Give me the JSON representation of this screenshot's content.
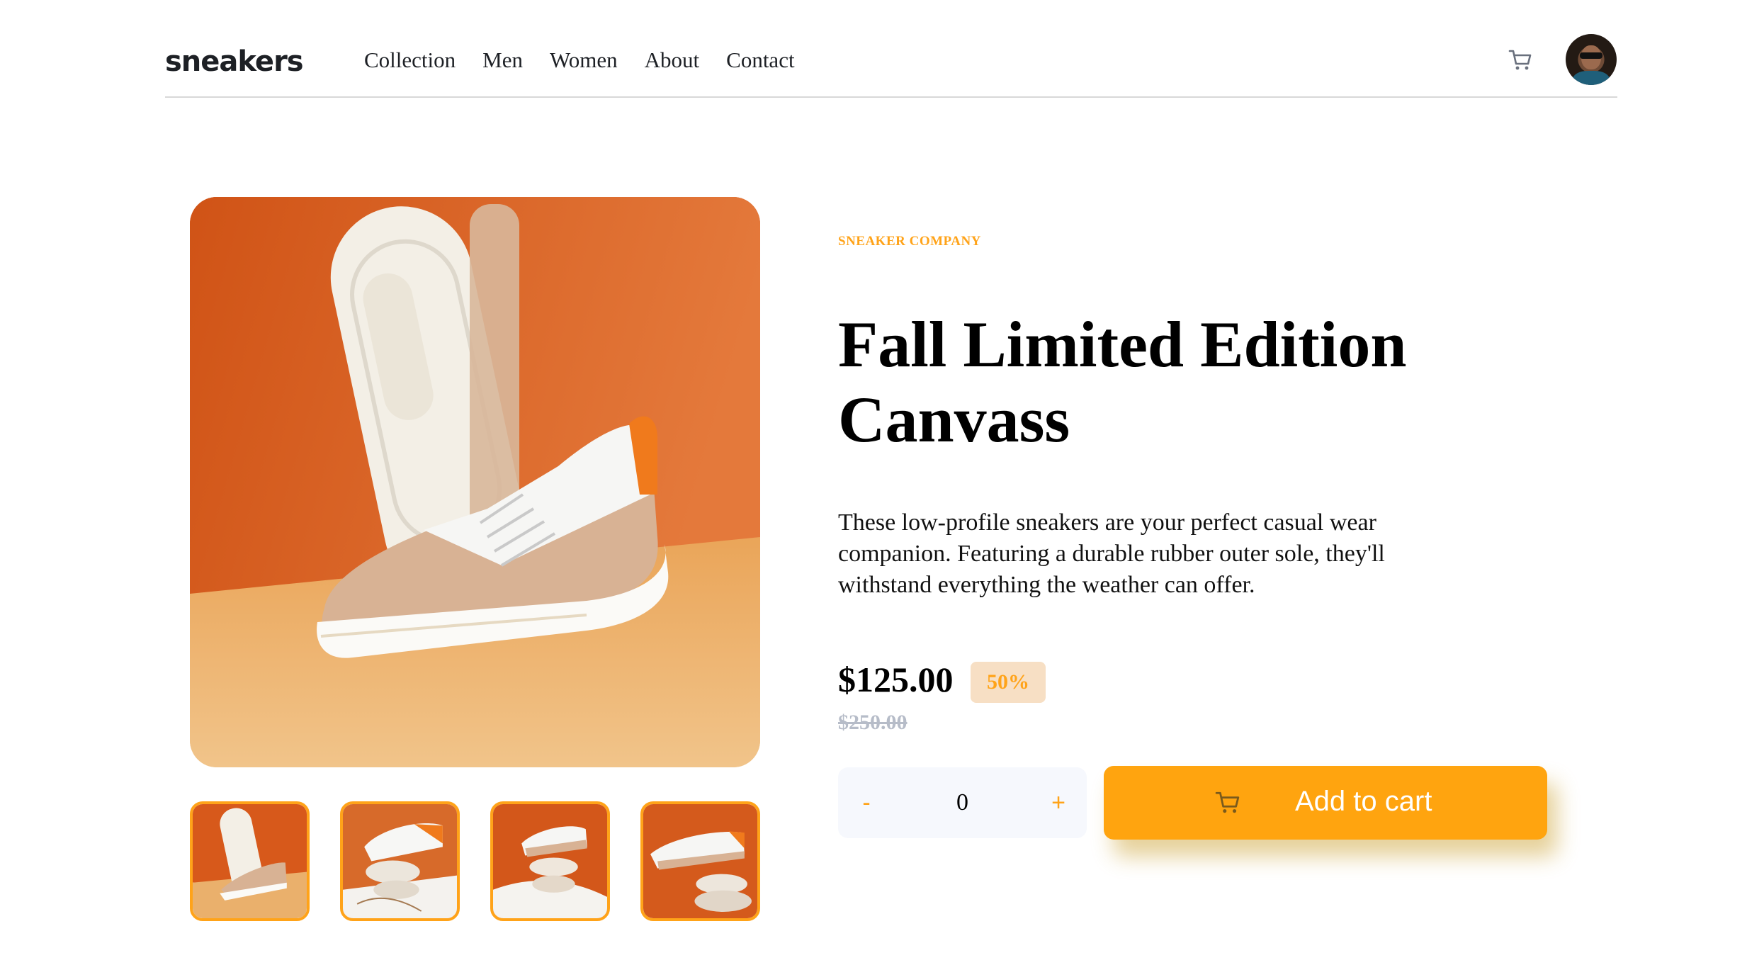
{
  "header": {
    "logo": "sneakers",
    "nav": [
      "Collection",
      "Men",
      "Women",
      "About",
      "Contact"
    ],
    "cart_icon": "cart-icon",
    "avatar_icon": "avatar"
  },
  "product": {
    "company": "SNEAKER COMPANY",
    "title": "Fall Limited Edition Canvass",
    "description": "These low-profile sneakers are your perfect casual wear companion. Featuring a durable rubber outer sole, they'll withstand everything the weather can offer.",
    "price": "$125.00",
    "discount": "50%",
    "original_price": "$250.00"
  },
  "quantity": {
    "minus_label": "-",
    "value": "0",
    "plus_label": "+"
  },
  "cart_button": {
    "label": "Add to cart",
    "icon": "cart-icon"
  },
  "gallery": {
    "thumbnails": [
      "product-1-thumbnail",
      "product-2-thumbnail",
      "product-3-thumbnail",
      "product-4-thumbnail"
    ],
    "selected_index": 0
  },
  "colors": {
    "accent": "#ffa319",
    "accent_pale": "#f7dfc4",
    "text_dark": "#1d2025",
    "muted": "#b6bcc8"
  }
}
